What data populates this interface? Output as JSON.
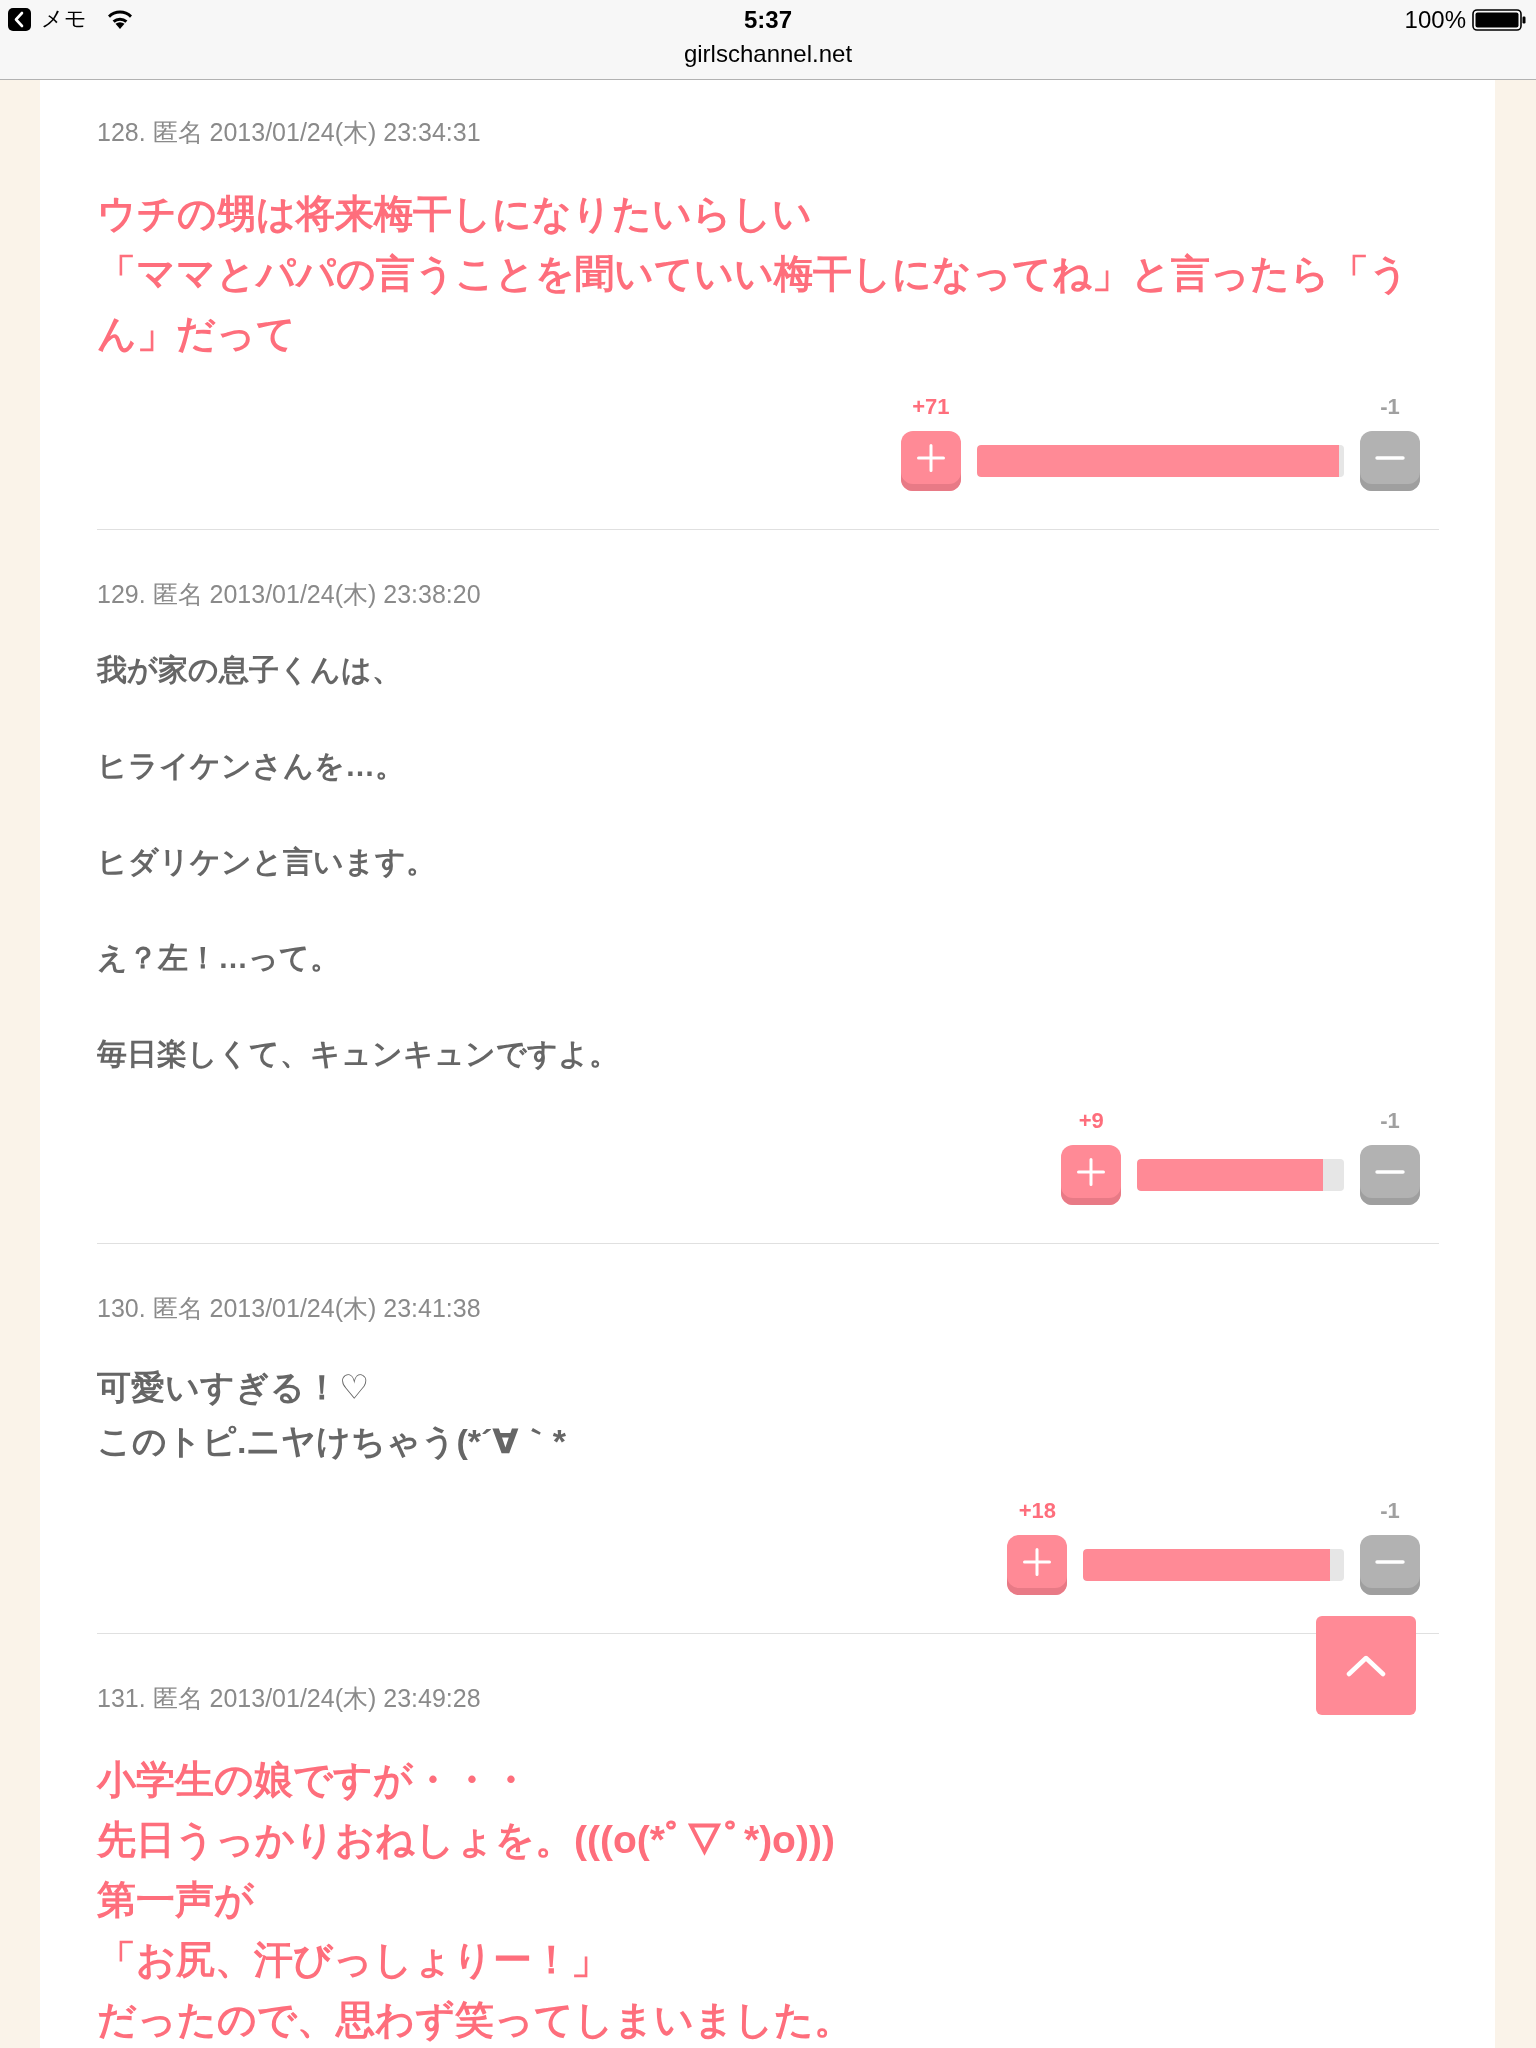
{
  "status_bar": {
    "back_label": "メモ",
    "time": "5:37",
    "url": "girlschannel.net",
    "battery": "100%"
  },
  "comments": [
    {
      "header": "128. 匿名 2013/01/24(木) 23:34:31",
      "kind": "highlight",
      "paragraphs": [
        [
          "ウチの甥は将来梅干しになりたいらしい",
          "「ママとパパの言うことを聞いていい梅干しになってね」と言ったら「うん」だって"
        ]
      ],
      "votes": {
        "plus": "+71",
        "minus": "-1",
        "level": 0.986
      }
    },
    {
      "header": "129. 匿名 2013/01/24(木) 23:38:20",
      "kind": "plain",
      "paragraphs": [
        [
          "我が家の息子くんは、"
        ],
        [
          "ヒライケンさんを…。"
        ],
        [
          "ヒダリケンと言います。"
        ],
        [
          "え？左！…って。"
        ],
        [
          "毎日楽しくて、キュンキュンですよ。"
        ]
      ],
      "votes": {
        "plus": "+9",
        "minus": "-1",
        "level": 0.9
      }
    },
    {
      "header": "130. 匿名 2013/01/24(木) 23:41:38",
      "kind": "large",
      "paragraphs": [
        [
          "可愛いすぎる！♡",
          "このトピ.ニヤけちゃう(*´∀｀*"
        ]
      ],
      "votes": {
        "plus": "+18",
        "minus": "-1",
        "level": 0.947
      }
    },
    {
      "header": "131. 匿名 2013/01/24(木) 23:49:28",
      "kind": "highlight",
      "paragraphs": [
        [
          "小学生の娘ですが・・・",
          "先日うっかりおねしょを。(((o(*ﾟ▽ﾟ*)o)))",
          "第一声が",
          "「お尻、汗びっしょりー！」",
          "だったので、思わず笑ってしまいました。"
        ]
      ]
    }
  ]
}
